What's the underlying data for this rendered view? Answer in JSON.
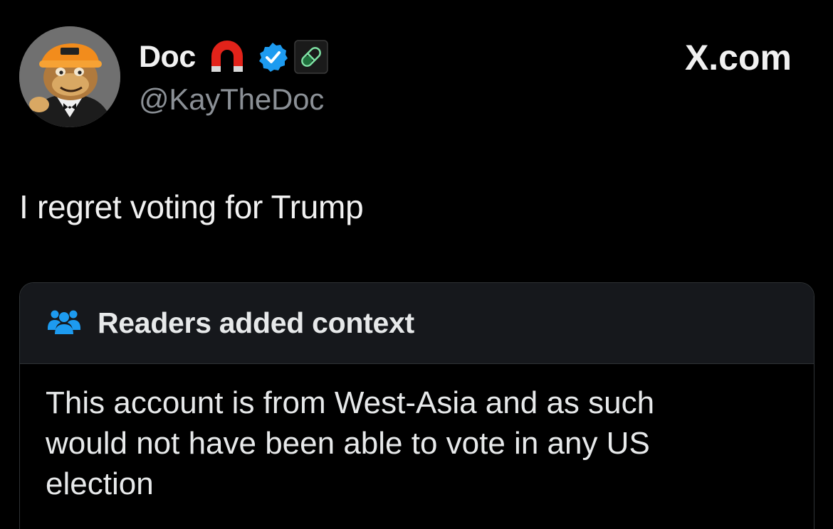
{
  "tweet": {
    "author": {
      "display_name": "Doc",
      "handle": "@KayTheDoc",
      "badges": [
        "magnet-icon",
        "verified-icon",
        "pill-icon"
      ]
    },
    "brand": "X.com",
    "text": "I regret voting for Trump"
  },
  "community_note": {
    "icon": "people-icon",
    "title": "Readers added context",
    "body": "This account is from West-Asia and as such would not have been able to vote in any US election"
  },
  "colors": {
    "background": "#000000",
    "verified_blue": "#1d9bf0",
    "note_icon_blue": "#1d9bf0",
    "magnet_red": "#e2231a",
    "pill_green": "#22c55e"
  }
}
